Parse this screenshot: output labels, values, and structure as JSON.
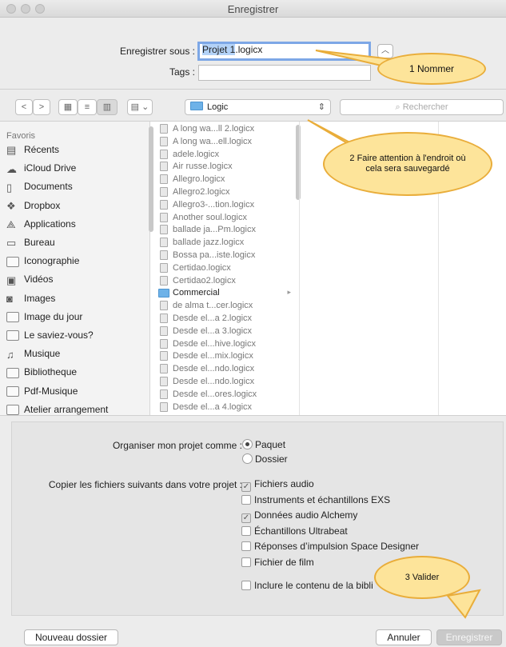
{
  "window": {
    "title": "Enregistrer"
  },
  "save": {
    "save_as_label": "Enregistrer sous :",
    "filename_selected": "Projet 1",
    "filename_ext": ".logicx",
    "tags_label": "Tags :"
  },
  "toolbar": {
    "location": "Logic",
    "search_placeholder": "Rechercher"
  },
  "sidebar": {
    "heading": "Favoris",
    "items": [
      {
        "label": "Récents",
        "icon": "recents-icon"
      },
      {
        "label": "iCloud Drive",
        "icon": "cloud-icon"
      },
      {
        "label": "Documents",
        "icon": "documents-icon"
      },
      {
        "label": "Dropbox",
        "icon": "dropbox-icon"
      },
      {
        "label": "Applications",
        "icon": "applications-icon"
      },
      {
        "label": "Bureau",
        "icon": "desktop-icon"
      },
      {
        "label": "Iconographie",
        "icon": "folder-icon"
      },
      {
        "label": "Vidéos",
        "icon": "film-icon"
      },
      {
        "label": "Images",
        "icon": "camera-icon"
      },
      {
        "label": "Image du jour",
        "icon": "folder-icon"
      },
      {
        "label": "Le saviez-vous?",
        "icon": "folder-icon"
      },
      {
        "label": "Musique",
        "icon": "music-note-icon"
      },
      {
        "label": "Bibliotheque",
        "icon": "folder-icon"
      },
      {
        "label": "Pdf-Musique",
        "icon": "folder-icon"
      },
      {
        "label": "Atelier arrangement",
        "icon": "folder-icon"
      }
    ]
  },
  "files": [
    "A long wa...ll 2.logicx",
    "A long wa...ell.logicx",
    "adele.logicx",
    "Air russe.logicx",
    "Allegro.logicx",
    "Allegro2.logicx",
    "Allegro3-...tion.logicx",
    "Another soul.logicx",
    "ballade ja...Pm.logicx",
    "ballade jazz.logicx",
    "Bossa pa...iste.logicx",
    "Certidao.logicx",
    "Certidao2.logicx",
    "Commercial",
    "de alma t...cer.logicx",
    "Desde el...a 2.logicx",
    "Desde el...a 3.logicx",
    "Desde el...hive.logicx",
    "Desde el...mix.logicx",
    "Desde el...ndo.logicx",
    "Desde el...ndo.logicx",
    "Desde el...ores.logicx",
    "Desde el...a 4.logicx"
  ],
  "options": {
    "organize_label": "Organiser mon projet comme :",
    "organize_options": [
      {
        "label": "Paquet",
        "selected": true
      },
      {
        "label": "Dossier",
        "selected": false
      }
    ],
    "copy_label": "Copier les fichiers suivants dans votre projet :",
    "copy_options": [
      {
        "label": "Fichiers audio",
        "checked": true
      },
      {
        "label": "Instruments et échantillons EXS",
        "checked": false
      },
      {
        "label": "Données audio Alchemy",
        "checked": true
      },
      {
        "label": "Échantillons Ultrabeat",
        "checked": false
      },
      {
        "label": "Réponses d’impulsion Space Designer",
        "checked": false
      },
      {
        "label": "Fichier de film",
        "checked": false
      },
      {
        "label": "Inclure le contenu de la bibli",
        "checked": false
      }
    ]
  },
  "buttons": {
    "new_folder": "Nouveau dossier",
    "cancel": "Annuler",
    "save": "Enregistrer"
  },
  "annotations": {
    "a1": "1 Nommer",
    "a2": "2 Faire attention à l'endroit où cela sera sauvegardé",
    "a3": "3 Valider"
  },
  "colors": {
    "bubble_fill": "#fde49a",
    "bubble_border": "#e9ad3a",
    "selection": "#b3d2f7",
    "focus_ring": "#7da7e6"
  }
}
